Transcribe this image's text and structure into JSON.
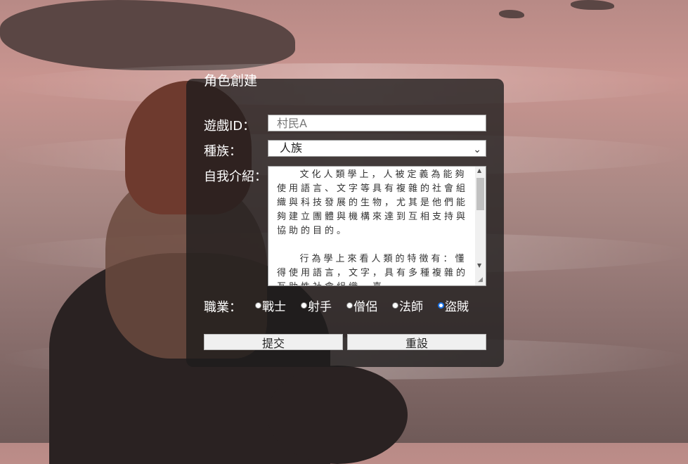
{
  "form": {
    "title": "角色創建",
    "game_id": {
      "label": "遊戲ID：",
      "placeholder": "村民A"
    },
    "race": {
      "label": "種族：",
      "value": "人族"
    },
    "intro": {
      "label": "自我介紹：",
      "text": "    文化人類學上，人被定義為能夠使用語言、文字等具有複雜的社會組織與科技發展的生物，尤其是他們能夠建立團體與機構來達到互相支持與協助的目的。\n\n    行為學上來看人類的特徵有：懂得使用語言，文字，具有多種複雜的互助性社會組織，喜"
    },
    "profession": {
      "label": "職業：",
      "options": [
        "戰士",
        "射手",
        "僧侶",
        "法師",
        "盜賊"
      ],
      "selected": "盜賊"
    },
    "submit_label": "提交",
    "reset_label": "重設"
  }
}
